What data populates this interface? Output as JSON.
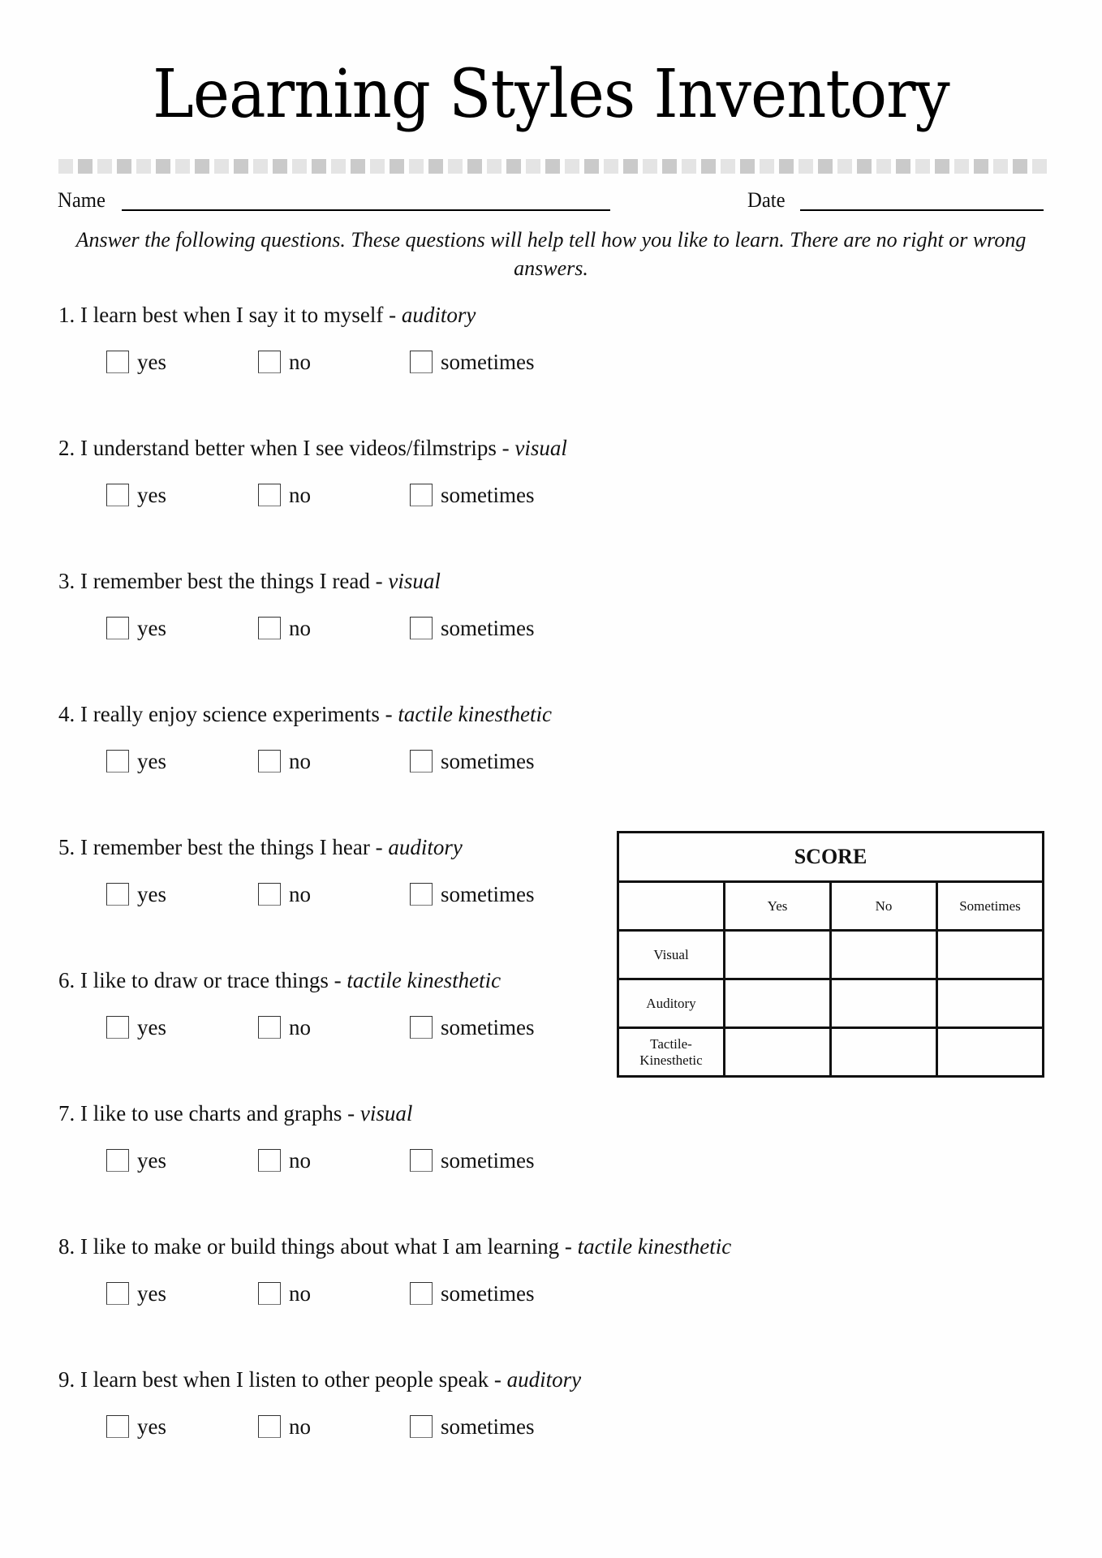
{
  "title": "Learning Styles Inventory",
  "header": {
    "name_label": "Name",
    "date_label": "Date",
    "name_value": "",
    "date_value": ""
  },
  "instructions": "Answer the following questions. These questions will help tell how you like to learn. There are no right or wrong answers.",
  "options": [
    "yes",
    "no",
    "sometimes"
  ],
  "questions": [
    {
      "number": "1.",
      "text": "I learn best when I say it to myself - ",
      "category": "auditory"
    },
    {
      "number": "2.",
      "text": "I understand better when I see videos/filmstrips - ",
      "category": "visual"
    },
    {
      "number": "3.",
      "text": "I remember best the things I read - ",
      "category": "visual"
    },
    {
      "number": "4.",
      "text": "I really enjoy science experiments - ",
      "category": "tactile kinesthetic"
    },
    {
      "number": "5.",
      "text": "I remember best the things I hear - ",
      "category": "auditory"
    },
    {
      "number": "6.",
      "text": "I like to draw or trace things - ",
      "category": "tactile kinesthetic"
    },
    {
      "number": "7.",
      "text": "I like to use charts and graphs - ",
      "category": "visual"
    },
    {
      "number": "8.",
      "text": "I like to make or build things about what I am learning - ",
      "category": "tactile kinesthetic"
    },
    {
      "number": "9.",
      "text": "I learn best when I listen to other people speak - ",
      "category": "auditory"
    }
  ],
  "score_table": {
    "title": "SCORE",
    "columns": [
      "",
      "Yes",
      "No",
      "Sometimes"
    ],
    "rows": [
      {
        "label": "Visual",
        "values": [
          "",
          "",
          ""
        ]
      },
      {
        "label": "Auditory",
        "values": [
          "",
          "",
          ""
        ]
      },
      {
        "label": "Tactile- Kinesthetic",
        "values": [
          "",
          "",
          ""
        ]
      }
    ]
  },
  "colors": {
    "pattern_light": "#e4e4e4",
    "pattern_dark": "#cacaca",
    "text": "#111111"
  }
}
